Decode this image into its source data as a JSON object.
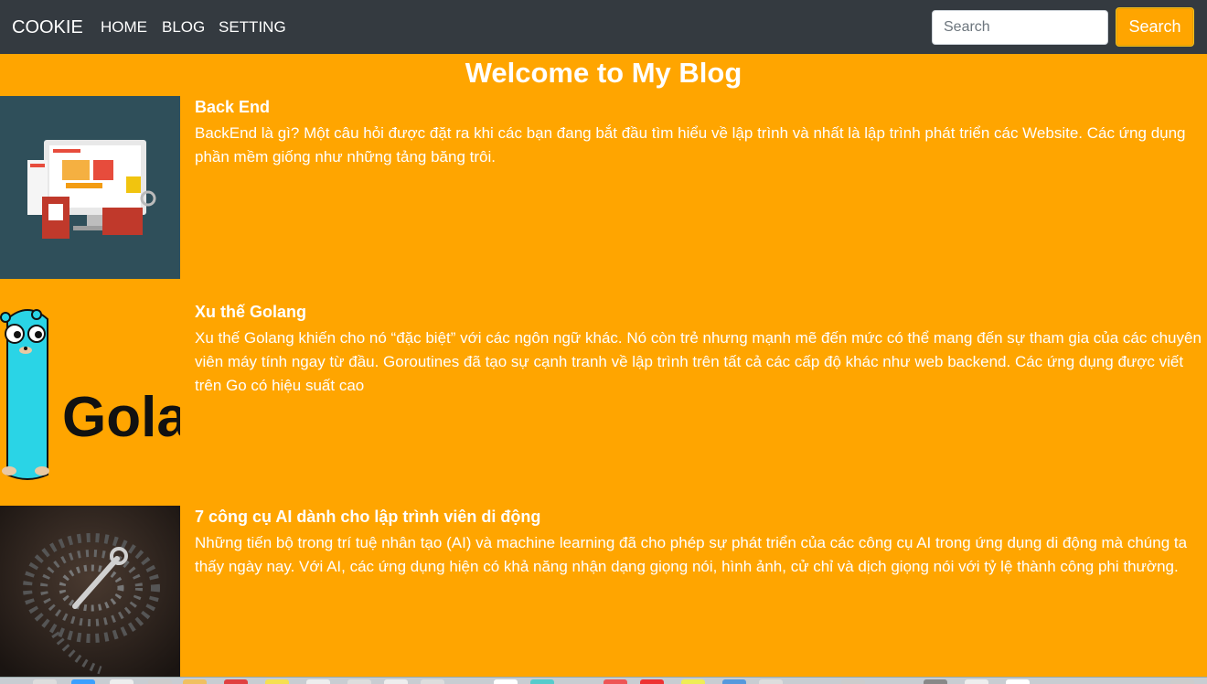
{
  "navbar": {
    "brand": "COOKIE",
    "links": [
      "HOME",
      "BLOG",
      "SETTING"
    ],
    "search": {
      "placeholder": "Search",
      "value": "",
      "button_label": "Search"
    }
  },
  "page": {
    "title": "Welcome to My Blog"
  },
  "posts": [
    {
      "title": "Back End",
      "excerpt": "BackEnd là gì? Một câu hỏi được đặt ra khi các bạn đang bắt đầu tìm hiểu về lập trình và nhất là lập trình phát triển các Website. Các ứng dụng phần mềm giống như những tảng băng trôi.",
      "thumbnail_icon": "web-development-illustration"
    },
    {
      "title": "Xu thế Golang",
      "excerpt": "Xu thế Golang khiến cho nó “đặc biệt” với các ngôn ngữ khác. Nó còn trẻ nhưng mạnh mẽ đến mức có thể mang đến sự tham gia của các chuyên viên máy tính ngay từ đầu. Goroutines đã tạo sự cạnh tranh về lập trình trên tất cả các cấp độ khác như web backend. Các ứng dụng được viết trên Go có hiệu suất cao",
      "thumbnail_icon": "golang-gopher-logo",
      "thumbnail_text": "Golang"
    },
    {
      "title": "7 công cụ AI dành cho lập trình viên di động",
      "excerpt": "Những tiến bộ trong trí tuệ nhân tạo (AI) và machine learning đã cho phép sự phát triển của các công cụ AI trong ứng dụng di động mà chúng ta thấy ngày nay. Với AI, các ứng dụng hiện có khả năng nhận dạng giọng nói, hình ảnh, cử chỉ và dịch giọng nói với tỷ lệ thành công phi thường.",
      "thumbnail_icon": "ai-brain-bolts-photo"
    }
  ],
  "colors": {
    "background": "#ffa500",
    "navbar": "#343a40",
    "text": "#ffffff"
  }
}
